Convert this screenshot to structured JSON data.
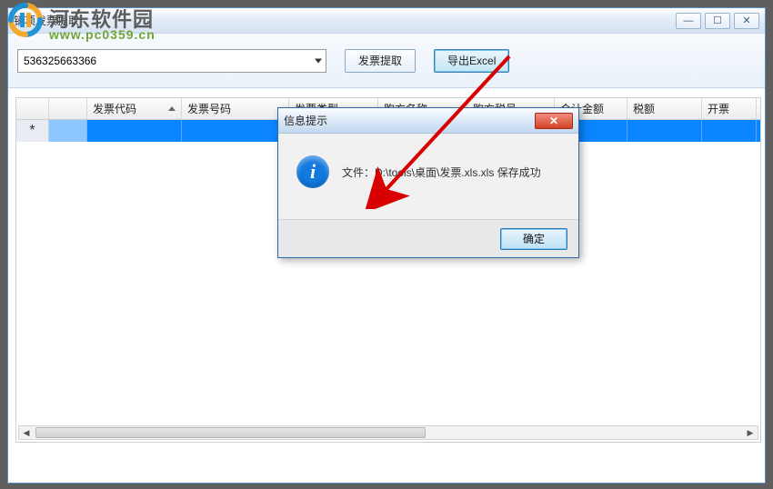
{
  "window": {
    "title": "销项发票提取",
    "min_glyph": "—",
    "max_glyph": "☐",
    "close_glyph": "✕"
  },
  "toolbar": {
    "combo_value": "536325663366",
    "extract_label": "发票提取",
    "export_label": "导出Excel"
  },
  "grid": {
    "columns": [
      {
        "label": "",
        "w": 36
      },
      {
        "label": "",
        "w": 42
      },
      {
        "label": "发票代码",
        "w": 104,
        "sorted": true
      },
      {
        "label": "发票号码",
        "w": 118
      },
      {
        "label": "发票类型",
        "w": 98
      },
      {
        "label": "购方名称",
        "w": 98
      },
      {
        "label": "购方税号",
        "w": 96
      },
      {
        "label": "合计金额",
        "w": 80
      },
      {
        "label": "税额",
        "w": 82
      },
      {
        "label": "开票",
        "w": 60
      }
    ],
    "row_marker": "*",
    "scroll_left": "◀",
    "scroll_right": "▶"
  },
  "dialog": {
    "title": "信息提示",
    "icon_glyph": "i",
    "message": "文件：D:\\tools\\桌面\\发票.xls.xls 保存成功",
    "ok_label": "确定",
    "close_glyph": "✕"
  },
  "watermark": {
    "brand": "河东软件园",
    "url": "www.pc0359.cn"
  }
}
